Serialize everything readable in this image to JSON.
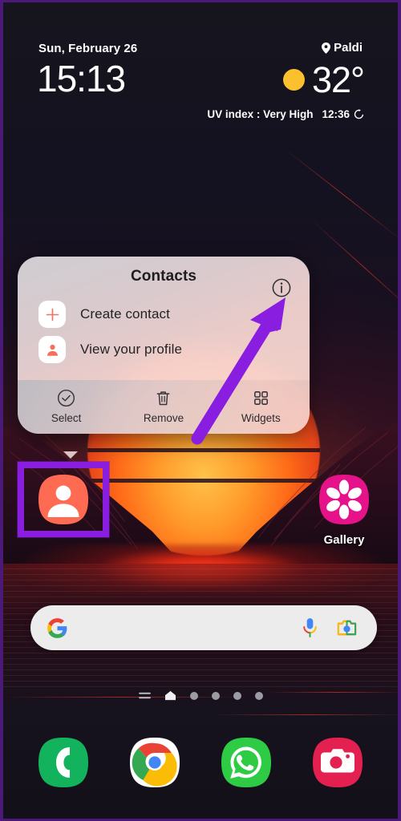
{
  "widget": {
    "date": "Sun, February 26",
    "time": "15:13",
    "location": "Paldi",
    "location_icon": "location-pin-icon",
    "weather_icon": "sun-icon",
    "temperature": "32°",
    "uv_index": "UV index : Very High",
    "refresh_time": "12:36",
    "refresh_icon": "refresh-icon"
  },
  "popup": {
    "title": "Contacts",
    "info_icon": "info-icon",
    "menu_items": [
      {
        "label": "Create contact",
        "icon": "plus-icon"
      },
      {
        "label": "View your profile",
        "icon": "person-icon"
      }
    ],
    "actions": [
      {
        "label": "Select",
        "icon": "check-circle-icon"
      },
      {
        "label": "Remove",
        "icon": "trash-icon"
      },
      {
        "label": "Widgets",
        "icon": "grid-squares-icon"
      }
    ]
  },
  "home": {
    "apps": [
      {
        "label": "",
        "icon": "contacts-icon",
        "highlighted": true
      },
      {
        "label": "Gallery",
        "icon": "gallery-icon",
        "highlighted": false
      }
    ]
  },
  "search": {
    "google_icon": "google-g-icon",
    "mic_icon": "microphone-icon",
    "lens_icon": "google-lens-camera-icon",
    "placeholder": ""
  },
  "page_indicator": {
    "list_icon": "app-list-icon",
    "home_icon": "home-page-icon",
    "dots": 4,
    "active_page": 1
  },
  "dock": {
    "apps": [
      {
        "icon": "phone-icon",
        "name": "Phone"
      },
      {
        "icon": "chrome-icon",
        "name": "Chrome"
      },
      {
        "icon": "whatsapp-icon",
        "name": "WhatsApp"
      },
      {
        "icon": "camera-icon",
        "name": "Camera"
      }
    ]
  },
  "annotation": {
    "arrow_icon": "purple-arrow-icon",
    "highlight_color": "#8a1ee0"
  },
  "colors": {
    "contacts_accent": "#ff6b52",
    "gallery_accent": "#e5128a",
    "phone_accent": "#1db954",
    "whatsapp_accent": "#2ecc45",
    "camera_accent": "#e3204f",
    "sun_yellow": "#fbc02d",
    "annotation_purple": "#8a1ee0"
  }
}
